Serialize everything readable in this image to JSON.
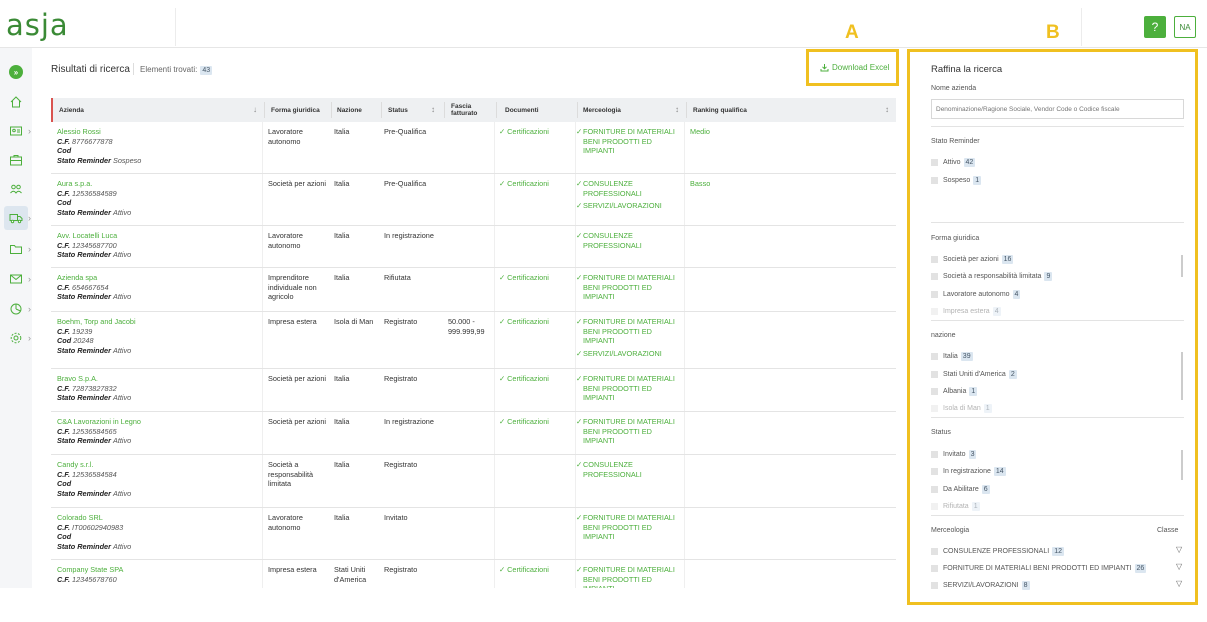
{
  "header": {
    "logo_text": "asja",
    "help_label": "?",
    "user_initials": "NA",
    "brand_color": "#4caf3c"
  },
  "sidebar": {
    "icons": [
      "expand-icon",
      "home-icon",
      "id-card-icon",
      "briefcase-icon",
      "users-icon",
      "truck-icon",
      "folder-icon",
      "mail-icon",
      "chart-icon",
      "gear-icon"
    ]
  },
  "results": {
    "title": "Risultati di ricerca",
    "count_label": "Elementi trovati:",
    "count": "43",
    "download_label": "Download Excel"
  },
  "markers": {
    "a": "A",
    "b": "B"
  },
  "table": {
    "headers": {
      "azienda": "Azienda",
      "forma": "Forma giuridica",
      "nazione": "Nazione",
      "status": "Status",
      "fascia": "Fascia fatturato",
      "documenti": "Documenti",
      "merceologia": "Merceologia",
      "ranking": "Ranking qualifica"
    },
    "rows": [
      {
        "name": "Alessio Rossi",
        "cf_label": "C.F.",
        "cf": "8776677878",
        "cod_label": "Cod",
        "cod": "",
        "sr_label": "Stato Reminder",
        "sr": "Sospeso",
        "forma": "Lavoratore autonomo",
        "nazione": "Italia",
        "status": "Pre-Qualifica",
        "fascia": "",
        "doc": "Certificazioni",
        "merc": [
          "FORNITURE DI MATERIALI BENI PRODOTTI ED IMPIANTI"
        ],
        "rank": "Medio"
      },
      {
        "name": "Aura s.p.a.",
        "cf_label": "C.F.",
        "cf": "12536584589",
        "cod_label": "Cod",
        "cod": "",
        "sr_label": "Stato Reminder",
        "sr": "Attivo",
        "forma": "Società per azioni",
        "nazione": "Italia",
        "status": "Pre-Qualifica",
        "fascia": "",
        "doc": "Certificazioni",
        "merc": [
          "CONSULENZE PROFESSIONALI",
          "SERVIZI/LAVORAZIONI"
        ],
        "rank": "Basso"
      },
      {
        "name": "Avv. Locatelli Luca",
        "cf_label": "C.F.",
        "cf": "12345687700",
        "cod_label": "",
        "cod": "",
        "sr_label": "Stato Reminder",
        "sr": "Attivo",
        "forma": "Lavoratore autonomo",
        "nazione": "Italia",
        "status": "In registrazione",
        "fascia": "",
        "doc": "",
        "merc": [
          "CONSULENZE PROFESSIONALI"
        ],
        "rank": ""
      },
      {
        "name": "Azienda spa",
        "cf_label": "C.F.",
        "cf": "654667654",
        "cod_label": "",
        "cod": "",
        "sr_label": "Stato Reminder",
        "sr": "Attivo",
        "forma": "Imprenditore individuale non agricolo",
        "nazione": "Italia",
        "status": "Rifiutata",
        "fascia": "",
        "doc": "Certificazioni",
        "merc": [
          "FORNITURE DI MATERIALI BENI PRODOTTI ED IMPIANTI"
        ],
        "rank": ""
      },
      {
        "name": "Boehm, Torp and Jacobi",
        "cf_label": "C.F.",
        "cf": "19239",
        "cod_label": "Cod",
        "cod": "20248",
        "sr_label": "Stato Reminder",
        "sr": "Attivo",
        "forma": "Impresa estera",
        "nazione": "Isola di Man",
        "status": "Registrato",
        "fascia": "50.000 - 999.999,99",
        "doc": "Certificazioni",
        "merc": [
          "FORNITURE DI MATERIALI BENI PRODOTTI ED IMPIANTI",
          "SERVIZI/LAVORAZIONI"
        ],
        "rank": ""
      },
      {
        "name": "Bravo S.p.A.",
        "cf_label": "C.F.",
        "cf": "72873827832",
        "cod_label": "",
        "cod": "",
        "sr_label": "Stato Reminder",
        "sr": "Attivo",
        "forma": "Società per azioni",
        "nazione": "Italia",
        "status": "Registrato",
        "fascia": "",
        "doc": "Certificazioni",
        "merc": [
          "FORNITURE DI MATERIALI BENI PRODOTTI ED IMPIANTI"
        ],
        "rank": ""
      },
      {
        "name": "C&A Lavorazioni in Legno",
        "cf_label": "C.F.",
        "cf": "12536584565",
        "cod_label": "",
        "cod": "",
        "sr_label": "Stato Reminder",
        "sr": "Attivo",
        "forma": "Società per azioni",
        "nazione": "Italia",
        "status": "In registrazione",
        "fascia": "",
        "doc": "Certificazioni",
        "merc": [
          "FORNITURE DI MATERIALI BENI PRODOTTI ED IMPIANTI"
        ],
        "rank": ""
      },
      {
        "name": "Candy s.r.l.",
        "cf_label": "C.F.",
        "cf": "12536584584",
        "cod_label": "Cod",
        "cod": "",
        "sr_label": "Stato Reminder",
        "sr": "Attivo",
        "forma": "Società a responsabilità limitata",
        "nazione": "Italia",
        "status": "Registrato",
        "fascia": "",
        "doc": "",
        "merc": [
          "CONSULENZE PROFESSIONALI"
        ],
        "rank": ""
      },
      {
        "name": "Colorado SRL",
        "cf_label": "C.F.",
        "cf": "IT00602940983",
        "cod_label": "Cod",
        "cod": "",
        "sr_label": "Stato Reminder",
        "sr": "Attivo",
        "forma": "Lavoratore autonomo",
        "nazione": "Italia",
        "status": "Invitato",
        "fascia": "",
        "doc": "",
        "merc": [
          "FORNITURE DI MATERIALI BENI PRODOTTI ED IMPIANTI"
        ],
        "rank": ""
      },
      {
        "name": "Company State SPA",
        "cf_label": "C.F.",
        "cf": "12345678760",
        "cod_label": "",
        "cod": "",
        "sr_label": "",
        "sr": "",
        "forma": "Impresa estera",
        "nazione": "Stati Uniti d'America",
        "status": "Registrato",
        "fascia": "",
        "doc": "Certificazioni",
        "merc": [
          "FORNITURE DI MATERIALI BENI PRODOTTI ED IMPIANTI"
        ],
        "rank": ""
      }
    ]
  },
  "refine": {
    "title": "Raffina la ricerca",
    "name_label": "Nome azienda",
    "name_placeholder": "Denominazione/Ragione Sociale, Vendor Code o Codice fiscale",
    "stato_label": "Stato Reminder",
    "stato": [
      {
        "label": "Attivo",
        "count": "42"
      },
      {
        "label": "Sospeso",
        "count": "1"
      }
    ],
    "forma_label": "Forma giuridica",
    "forma": [
      {
        "label": "Società per azioni",
        "count": "16"
      },
      {
        "label": "Società a responsabilità limitata",
        "count": "9"
      },
      {
        "label": "Lavoratore autonomo",
        "count": "4"
      },
      {
        "label": "Impresa estera",
        "count": "4"
      }
    ],
    "nazione_label": "nazione",
    "nazione": [
      {
        "label": "Italia",
        "count": "39"
      },
      {
        "label": "Stati Uniti d'America",
        "count": "2"
      },
      {
        "label": "Albania",
        "count": "1"
      },
      {
        "label": "Isola di Man",
        "count": "1"
      }
    ],
    "status_label": "Status",
    "status": [
      {
        "label": "Invitato",
        "count": "3"
      },
      {
        "label": "In registrazione",
        "count": "14"
      },
      {
        "label": "Da Abilitare",
        "count": "6"
      },
      {
        "label": "Rifiutata",
        "count": "1"
      }
    ],
    "merc_label": "Merceologia",
    "classe_label": "Classe",
    "merc": [
      {
        "label": "CONSULENZE PROFESSIONALI",
        "count": "12"
      },
      {
        "label": "FORNITURE DI MATERIALI BENI PRODOTTI ED IMPIANTI",
        "count": "26"
      },
      {
        "label": "SERVIZI/LAVORAZIONI",
        "count": "8"
      }
    ]
  }
}
